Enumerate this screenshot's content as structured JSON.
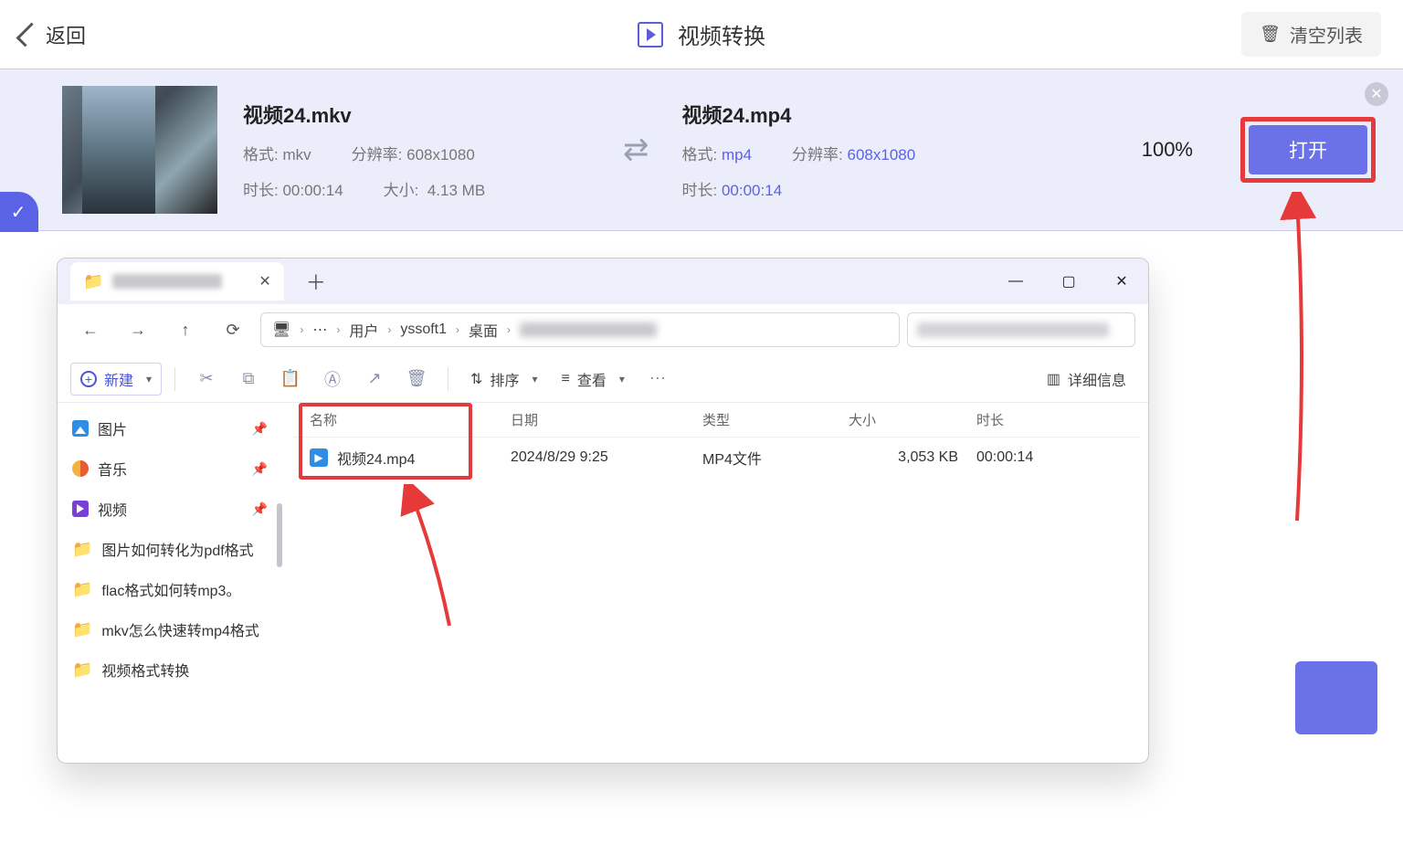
{
  "header": {
    "back": "返回",
    "title": "视频转换",
    "clear": "清空列表"
  },
  "row": {
    "src": {
      "name": "视频24.mkv",
      "fmt_label": "格式:",
      "fmt": "mkv",
      "res_label": "分辨率:",
      "res": "608x1080",
      "dur_label": "时长:",
      "dur": "00:00:14",
      "size_label": "大小:",
      "size": "4.13 MB"
    },
    "dst": {
      "name": "视频24.mp4",
      "fmt_label": "格式:",
      "fmt": "mp4",
      "res_label": "分辨率:",
      "res": "608x1080",
      "dur_label": "时长:",
      "dur": "00:00:14"
    },
    "progress": "100%",
    "open": "打开"
  },
  "explorer": {
    "new": "新建",
    "sort": "排序",
    "view": "查看",
    "details": "详细信息",
    "crumbs": {
      "user": "用户",
      "acct": "yssoft1",
      "desktop": "桌面"
    },
    "sidebar": {
      "pictures": "图片",
      "music": "音乐",
      "videos": "视频",
      "f1": "图片如何转化为pdf格式",
      "f2": "flac格式如何转mp3。",
      "f3": "mkv怎么快速转mp4格式",
      "f4": "视频格式转换"
    },
    "cols": {
      "name": "名称",
      "date": "日期",
      "type": "类型",
      "size": "大小",
      "dur": "时长"
    },
    "file": {
      "name": "视频24.mp4",
      "date": "2024/8/29 9:25",
      "type": "MP4文件",
      "size": "3,053 KB",
      "dur": "00:00:14"
    }
  }
}
